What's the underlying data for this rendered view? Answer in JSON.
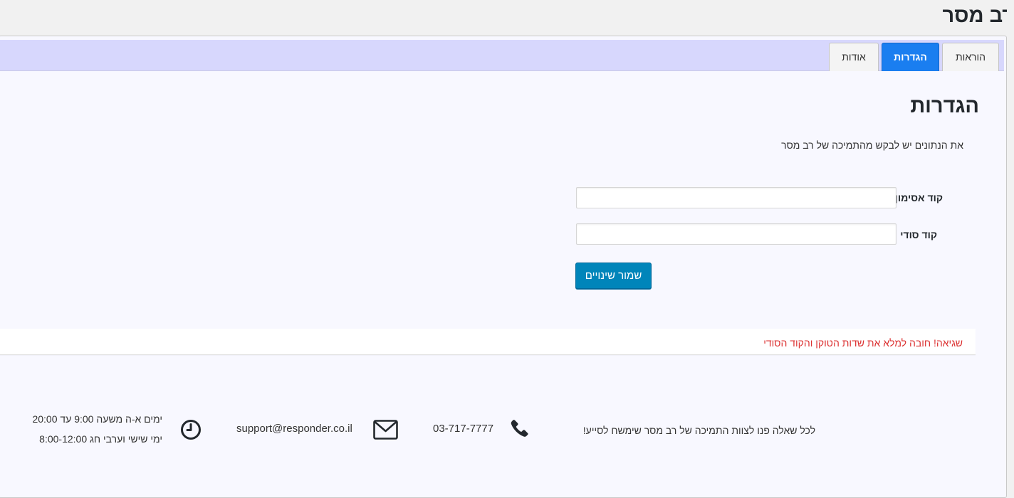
{
  "header": {
    "title": "רב מסר"
  },
  "tabs": [
    {
      "label": "הוראות",
      "active": false
    },
    {
      "label": "הגדרות",
      "active": true
    },
    {
      "label": "אודות",
      "active": false
    }
  ],
  "settings": {
    "heading": "הגדרות",
    "intro": "את הנתונים יש לבקש מהתמיכה של רב מסר",
    "token_label": "קוד אסימון",
    "token_value": "",
    "secret_label": "קוד סודי",
    "secret_value": "",
    "save_label": "שמור שינויים"
  },
  "notice": {
    "text": "שגיאה! חובה למלא את שדות הטוקן והקוד הסודי",
    "color": "#dc3232"
  },
  "footer": {
    "help_text": "לכל שאלה פנו לצוות התמיכה של רב מסר שימשח לסייע!",
    "phone": "03-717-7777",
    "email": "support@responder.co.il",
    "hours_weekdays": "ימים א-ה משעה 9:00 עד 20:00",
    "hours_friday": "ימי שישי וערבי חג 8:00-12:00",
    "icons": [
      "phone-icon",
      "envelope-icon",
      "clock-icon"
    ]
  },
  "colors": {
    "accent": "#0085ba",
    "active_tab": "#1a7ef0",
    "tabbar": "#d7d7fd",
    "panel": "#f8f8ff"
  }
}
